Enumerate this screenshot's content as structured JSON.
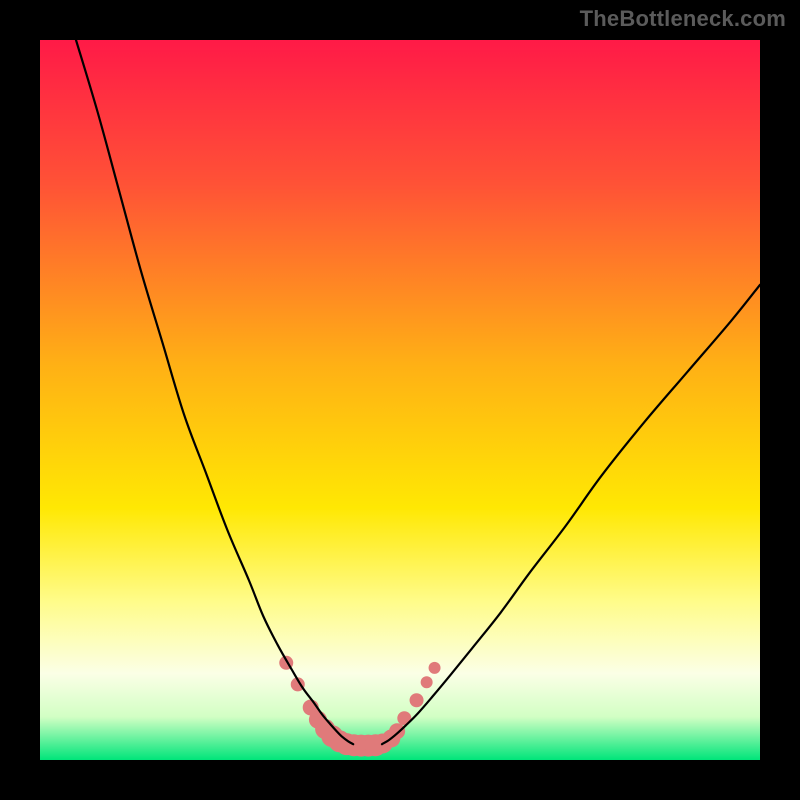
{
  "watermark": "TheBottleneck.com",
  "chart_data": {
    "type": "line",
    "title": "",
    "xlabel": "",
    "ylabel": "",
    "xlim": [
      0,
      100
    ],
    "ylim": [
      0,
      100
    ],
    "grid": false,
    "background_gradient": {
      "stops": [
        {
          "offset": 0.0,
          "color": "#ff1a47"
        },
        {
          "offset": 0.2,
          "color": "#ff5236"
        },
        {
          "offset": 0.45,
          "color": "#ffb015"
        },
        {
          "offset": 0.65,
          "color": "#ffe803"
        },
        {
          "offset": 0.78,
          "color": "#fffc8a"
        },
        {
          "offset": 0.88,
          "color": "#fbffe6"
        },
        {
          "offset": 0.94,
          "color": "#d2ffc4"
        },
        {
          "offset": 1.0,
          "color": "#00e57a"
        }
      ]
    },
    "series": [
      {
        "name": "left-curve",
        "color": "#000000",
        "width": 2.2,
        "x": [
          5,
          8,
          11,
          14,
          17,
          20,
          23,
          26,
          29,
          31,
          33,
          35,
          36.5,
          38,
          39.2,
          40.3,
          41.2,
          42,
          42.8,
          43.5
        ],
        "y": [
          100,
          90,
          79,
          68,
          58,
          48,
          40,
          32,
          25,
          20,
          16,
          12.5,
          10,
          8,
          6.3,
          5,
          4,
          3.2,
          2.6,
          2.2
        ]
      },
      {
        "name": "right-curve",
        "color": "#000000",
        "width": 2.2,
        "x": [
          47.5,
          48.5,
          49.5,
          50.8,
          52.5,
          54.5,
          57,
          60,
          64,
          68,
          73,
          78,
          84,
          90,
          96,
          100
        ],
        "y": [
          2.2,
          2.8,
          3.6,
          4.8,
          6.5,
          8.8,
          11.8,
          15.5,
          20.5,
          26,
          32.5,
          39.5,
          47,
          54,
          61,
          66
        ]
      },
      {
        "name": "marker-blobs",
        "type": "scatter",
        "color": "#e07a7a",
        "radius_range": [
          6,
          12
        ],
        "points": [
          {
            "x": 34.2,
            "y": 13.5,
            "r": 7
          },
          {
            "x": 35.8,
            "y": 10.5,
            "r": 7
          },
          {
            "x": 37.6,
            "y": 7.3,
            "r": 8
          },
          {
            "x": 38.6,
            "y": 5.6,
            "r": 9
          },
          {
            "x": 39.6,
            "y": 4.3,
            "r": 10
          },
          {
            "x": 40.6,
            "y": 3.3,
            "r": 11
          },
          {
            "x": 41.6,
            "y": 2.6,
            "r": 11
          },
          {
            "x": 42.6,
            "y": 2.2,
            "r": 11
          },
          {
            "x": 43.6,
            "y": 2.05,
            "r": 11
          },
          {
            "x": 44.6,
            "y": 2.0,
            "r": 11
          },
          {
            "x": 45.6,
            "y": 2.0,
            "r": 11
          },
          {
            "x": 46.6,
            "y": 2.05,
            "r": 11
          },
          {
            "x": 47.6,
            "y": 2.3,
            "r": 10
          },
          {
            "x": 48.8,
            "y": 3.0,
            "r": 9
          },
          {
            "x": 49.6,
            "y": 4.0,
            "r": 8
          },
          {
            "x": 50.6,
            "y": 5.8,
            "r": 7
          },
          {
            "x": 52.3,
            "y": 8.3,
            "r": 7
          },
          {
            "x": 53.7,
            "y": 10.8,
            "r": 6
          },
          {
            "x": 54.8,
            "y": 12.8,
            "r": 6
          }
        ]
      }
    ]
  }
}
